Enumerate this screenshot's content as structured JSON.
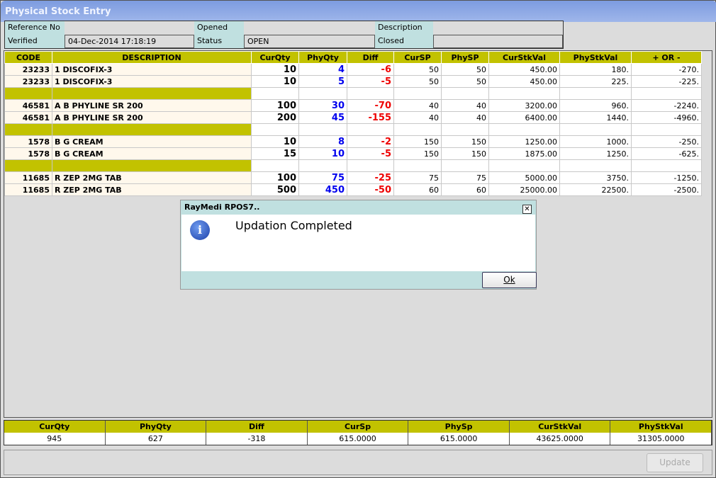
{
  "window": {
    "title": "Physical Stock Entry"
  },
  "info": {
    "reference_label": "Reference No",
    "reference_value": "",
    "opened_label": "Opened",
    "opened_value": "",
    "description_label": "Description",
    "description_value": "",
    "verified_label": "Verified",
    "verified_value": "04-Dec-2014 17:18:19",
    "status_label": "Status",
    "status_value": "OPEN",
    "closed_label": "Closed",
    "closed_value": ""
  },
  "table": {
    "headers": [
      "CODE",
      "DESCRIPTION",
      "CurQty",
      "PhyQty",
      "Diff",
      "CurSP",
      "PhySP",
      "CurStkVal",
      "PhyStkVal",
      "+ OR -"
    ],
    "rows": [
      [
        "23233",
        "1 DISCOFIX-3",
        "10",
        "4",
        "-6",
        "50",
        "50",
        "450.00",
        "180.",
        "-270."
      ],
      [
        "23233",
        "1 DISCOFIX-3",
        "10",
        "5",
        "-5",
        "50",
        "50",
        "450.00",
        "225.",
        "-225."
      ],
      [
        "",
        "",
        "",
        "",
        "",
        "",
        "",
        "",
        "",
        ""
      ],
      [
        "46581",
        "A B PHYLINE SR 200",
        "100",
        "30",
        "-70",
        "40",
        "40",
        "3200.00",
        "960.",
        "-2240."
      ],
      [
        "46581",
        "A B PHYLINE SR 200",
        "200",
        "45",
        "-155",
        "40",
        "40",
        "6400.00",
        "1440.",
        "-4960."
      ],
      [
        "",
        "",
        "",
        "",
        "",
        "",
        "",
        "",
        "",
        ""
      ],
      [
        "1578",
        "B G CREAM",
        "10",
        "8",
        "-2",
        "150",
        "150",
        "1250.00",
        "1000.",
        "-250."
      ],
      [
        "1578",
        "B G CREAM",
        "15",
        "10",
        "-5",
        "150",
        "150",
        "1875.00",
        "1250.",
        "-625."
      ],
      [
        "",
        "",
        "",
        "",
        "",
        "",
        "",
        "",
        "",
        ""
      ],
      [
        "11685",
        "R ZEP 2MG TAB",
        "100",
        "75",
        "-25",
        "75",
        "75",
        "5000.00",
        "3750.",
        "-1250."
      ],
      [
        "11685",
        "R ZEP 2MG TAB",
        "500",
        "450",
        "-50",
        "60",
        "60",
        "25000.00",
        "22500.",
        "-2500."
      ]
    ]
  },
  "summary": {
    "headers": [
      "CurQty",
      "PhyQty",
      "Diff",
      "CurSp",
      "PhySp",
      "CurStkVal",
      "PhyStkVal"
    ],
    "values": [
      "945",
      "627",
      "-318",
      "615.0000",
      "615.0000",
      "43625.0000",
      "31305.0000"
    ]
  },
  "footer": {
    "update_label": "Update"
  },
  "dialog": {
    "title": "RayMedi RPOS7..",
    "message": "Updation Completed",
    "ok_label": "Ok",
    "close_glyph": "✕",
    "info_glyph": "i"
  }
}
